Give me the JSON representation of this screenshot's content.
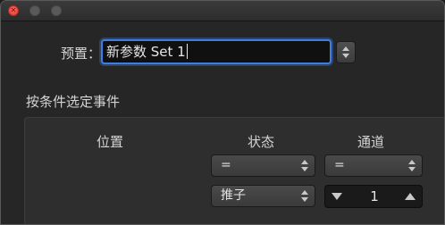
{
  "window": {
    "controls": [
      "close-icon",
      "minimize-icon",
      "zoom-icon"
    ]
  },
  "preset": {
    "label": "预置：",
    "value": "新参数 Set 1"
  },
  "section": {
    "title": "按条件选定事件"
  },
  "columns": {
    "position": "位置",
    "status": "状态",
    "channel": "通道"
  },
  "row1": {
    "status_op": "=",
    "channel_op": "="
  },
  "row2": {
    "status_value": "推子",
    "channel_value": "1"
  },
  "colors": {
    "focus_ring": "#3f7ee0",
    "close_button": "#ff5f57",
    "background": "#262626",
    "group_background": "#2e2e2e"
  }
}
